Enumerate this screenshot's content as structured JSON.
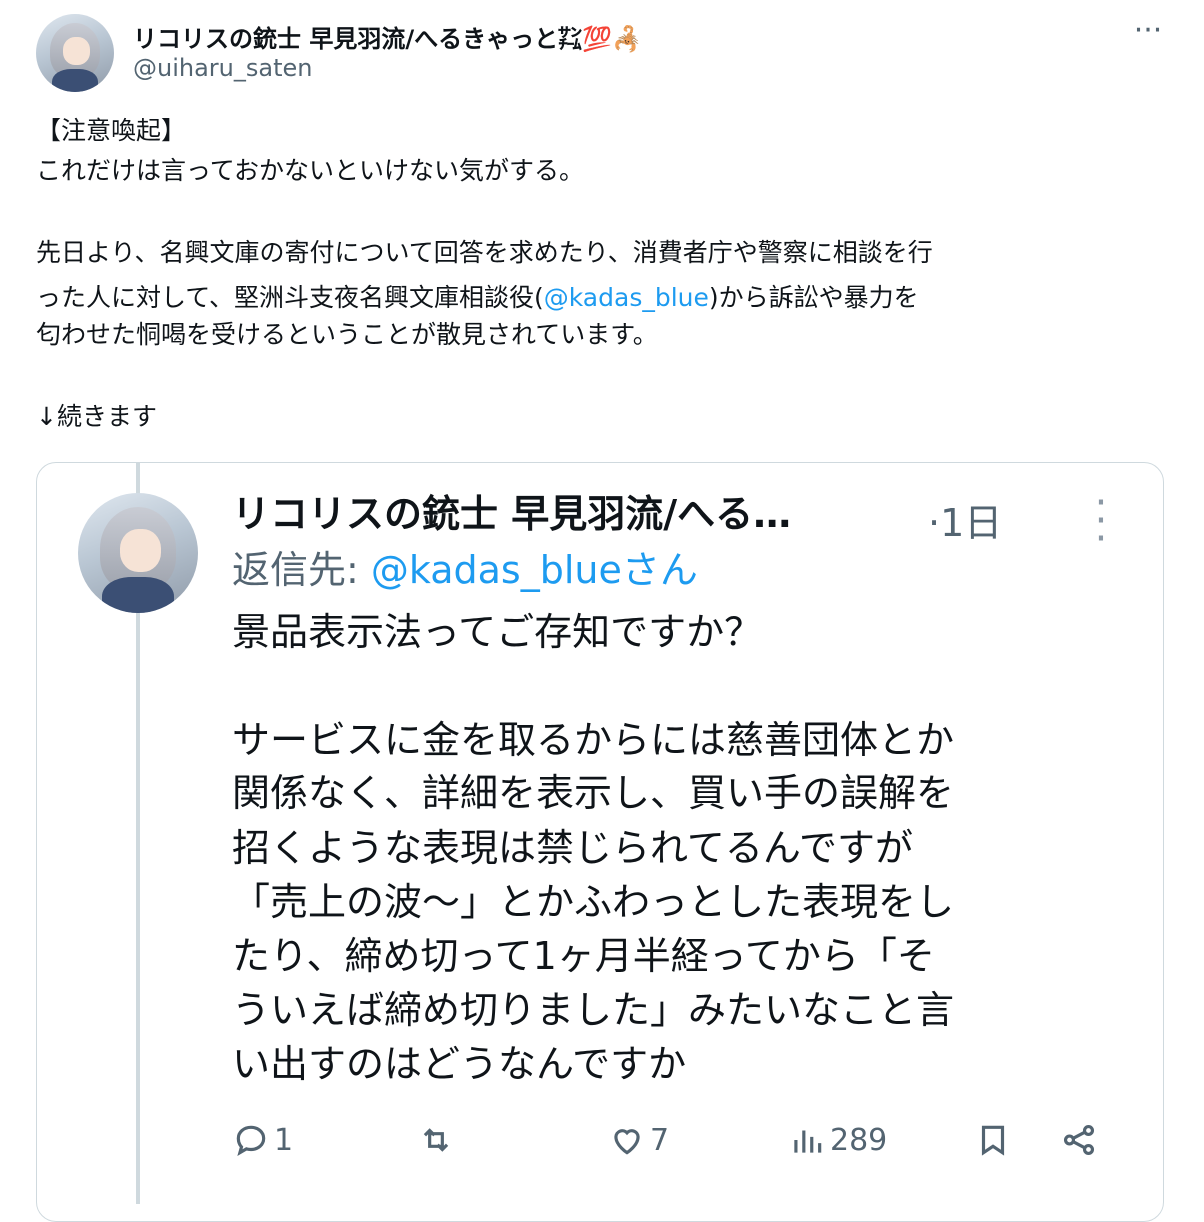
{
  "author": {
    "display_name": "リコリスの銃士 早見羽流/へるきゃっと㌠💯🦂",
    "handle": "@uiharu_saten"
  },
  "tweet": {
    "line1": "【注意喚起】",
    "line2": "これだけは言っておかないといけない気がする。",
    "line3": "先日より、名興文庫の寄付について回答を求めたり、消費者庁や警察に相談を行",
    "line4_pre": "った人に対して、堅洲斗支夜名興文庫相談役(",
    "line4_link": "@kadas_blue",
    "line4_post": ")から訴訟や暴力を",
    "line5": "匂わせた恫喝を受けるということが散見されています。",
    "line6": "↓続きます"
  },
  "quote": {
    "name": "リコリスの銃士 早見羽流/へる…",
    "time": "·1日",
    "reply_prefix": "返信先: ",
    "reply_link": "@kadas_blueさん",
    "lines": [
      "景品表示法ってご存知ですか？",
      "サービスに金を取るからには慈善団体とか",
      "関係なく、詳細を表示し、買い手の誤解を",
      "招くような表現は禁じられてるんですが",
      "「売上の波〜」とかふわっとした表現をし",
      "たり、締め切って1ヶ月半経ってから「そ",
      "ういえば締め切りました」みたいなこと言",
      "い出すのはどうなんですか"
    ],
    "actions": {
      "reply_count": "1",
      "like_count": "7",
      "view_count": "289"
    }
  },
  "icons": [
    "more-icon",
    "reply-icon",
    "retweet-icon",
    "like-icon",
    "views-icon",
    "bookmark-icon",
    "share-icon"
  ],
  "colors": {
    "link": "#1d9bf0",
    "secondary": "#536471",
    "border": "#cfd9de"
  }
}
